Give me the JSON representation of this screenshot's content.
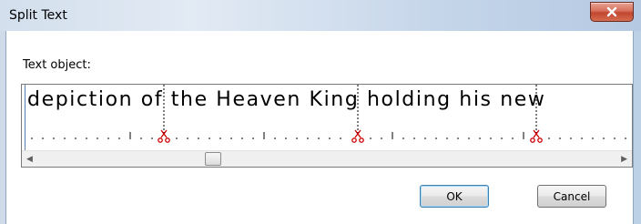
{
  "window": {
    "title": "Split Text",
    "close_icon": "close-icon (X)"
  },
  "dialog": {
    "label": "Text object:",
    "text_content": "depiction of the Heaven King holding his new",
    "split_marker_icon": "scissors-icon",
    "colors": {
      "split_marker": "#cc0000",
      "close_button": "#c2462f"
    }
  },
  "buttons": {
    "ok": "OK",
    "cancel": "Cancel"
  }
}
